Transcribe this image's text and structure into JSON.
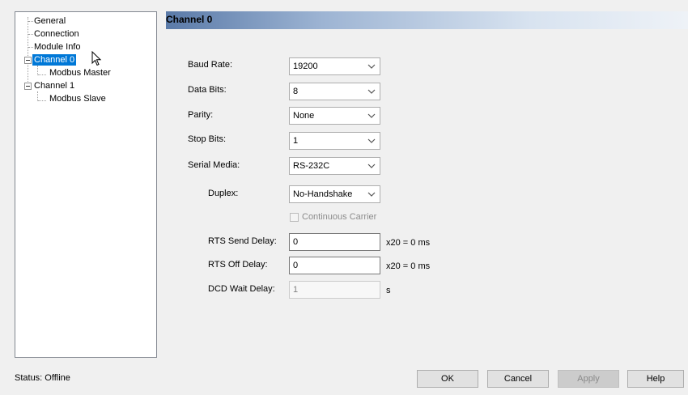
{
  "tree": {
    "items": [
      {
        "label": "General"
      },
      {
        "label": "Connection"
      },
      {
        "label": "Module Info"
      },
      {
        "label": "Channel 0"
      },
      {
        "label": "Modbus Master"
      },
      {
        "label": "Channel 1"
      },
      {
        "label": "Modbus Slave"
      }
    ],
    "selected": "Channel 0"
  },
  "header": {
    "title": "Channel 0"
  },
  "form": {
    "baud_rate": {
      "label": "Baud Rate:",
      "value": "19200"
    },
    "data_bits": {
      "label": "Data Bits:",
      "value": "8"
    },
    "parity": {
      "label": "Parity:",
      "value": "None"
    },
    "stop_bits": {
      "label": "Stop Bits:",
      "value": "1"
    },
    "serial_media": {
      "label": "Serial Media:",
      "value": "RS-232C"
    },
    "duplex": {
      "label": "Duplex:",
      "value": "No-Handshake"
    },
    "continuous_carrier": {
      "label": "Continuous Carrier",
      "checked": false,
      "enabled": false
    },
    "rts_send_delay": {
      "label": "RTS Send Delay:",
      "value": "0",
      "unit": "x20 = 0 ms"
    },
    "rts_off_delay": {
      "label": "RTS Off Delay:",
      "value": "0",
      "unit": "x20 = 0 ms"
    },
    "dcd_wait_delay": {
      "label": "DCD Wait Delay:",
      "value": "1",
      "unit": "s"
    }
  },
  "status": {
    "text": "Status:  Offline"
  },
  "buttons": {
    "ok": "OK",
    "cancel": "Cancel",
    "apply": "Apply",
    "help": "Help"
  }
}
